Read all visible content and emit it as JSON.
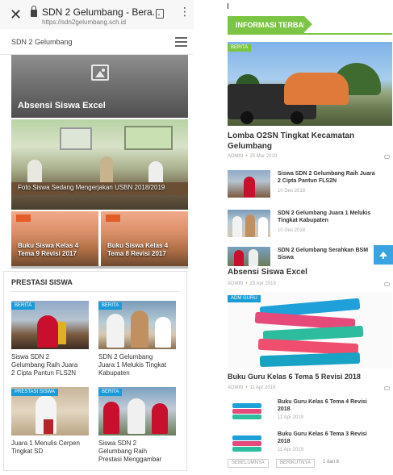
{
  "browser": {
    "close_icon": "close-icon",
    "title": "SDN 2 Gelumbang - Bera...",
    "url": "https://sdn2gelumbang.sch.id",
    "bookmark_icon": "bookmark-icon",
    "menu_icon": "kebab-menu-icon"
  },
  "site": {
    "name": "SDN 2 Gelumbang",
    "menu_icon": "hamburger-icon"
  },
  "slider": {
    "top_card": {
      "title": "Absensi Siswa Excel",
      "icon": "image-placeholder-icon"
    },
    "mid_card": {
      "title": "Foto Siswa Sedang Mengerjakan USBN 2018/2019"
    },
    "small_cards": [
      {
        "line1": "Buku Siswa Kelas 4",
        "line2": "Tema 9 Revisi 2017"
      },
      {
        "line1": "Buku Siswa Kelas 4",
        "line2": "Tema 8 Revisi 2017"
      }
    ]
  },
  "prestasi": {
    "heading": "PRESTASI SISWA",
    "items": [
      {
        "badge": "BERITA",
        "lines": [
          "Siswa SDN 2",
          "Gelumbang Raih Juara",
          "2 Cipta Pantun FLS2N"
        ]
      },
      {
        "badge": "BERITA",
        "lines": [
          "SDN 2 Gelumbang",
          "Juara 1 Melukis Tingkat",
          "Kabupaten"
        ]
      },
      {
        "badge": "PRESTASI SISWA",
        "lines": [
          "Juara 1 Menulis Cerpen",
          "Tingkat SD"
        ]
      },
      {
        "badge": "BERITA",
        "lines": [
          "Siswa SDN 2",
          "Gelumbang Raih",
          "Prestasi Menggambar"
        ]
      }
    ]
  },
  "right": {
    "section_badge": "INFORMASI TERBARU",
    "featured": {
      "badge": "BERITA",
      "title_lines": [
        "Lomba O2SN Tingkat Kecamatan",
        "Gelumbang"
      ],
      "author": "ADMIN",
      "date": "25 Mar 2019"
    },
    "list": [
      {
        "lines": [
          "Siswa SDN 2 Gelumbang Raih Juara",
          "2 Cipta Pantun FLS2N"
        ],
        "date": "10 Des 2018"
      },
      {
        "lines": [
          "SDN 2 Gelumbang Juara 1 Melukis",
          "Tingkat Kabupaten"
        ],
        "date": "10 Des 2018"
      },
      {
        "lines": [
          "SDN 2 Gelumbang Serahkan BSM",
          "Siswa"
        ],
        "date": ""
      }
    ],
    "second_heading": "Absensi Siswa Excel",
    "second_meta": {
      "author": "ADMIN",
      "date": "23 Apr 2019"
    },
    "books": {
      "badge": "ADM GURU",
      "title": "Buku Guru Kelas 6 Tema 5 Revisi 2018",
      "author": "ADMIN",
      "date": "11 Apr 2019"
    },
    "book_list": [
      {
        "lines": [
          "Buku Guru Kelas 6 Tema 4 Revisi",
          "2018"
        ],
        "date": "11 Apr 2019"
      },
      {
        "lines": [
          "Buku Guru Kelas 6 Tema 3 Revisi",
          "2018"
        ],
        "date": "11 Apr 2019"
      }
    ],
    "pager": {
      "prev": "SEBELUMNYA",
      "next": "BERIKUTNYA",
      "info": "1 dari 8"
    }
  },
  "colors": {
    "green": "#7cc544",
    "blue": "#1a9bd7",
    "scroll_button": "#3aa4e0"
  }
}
